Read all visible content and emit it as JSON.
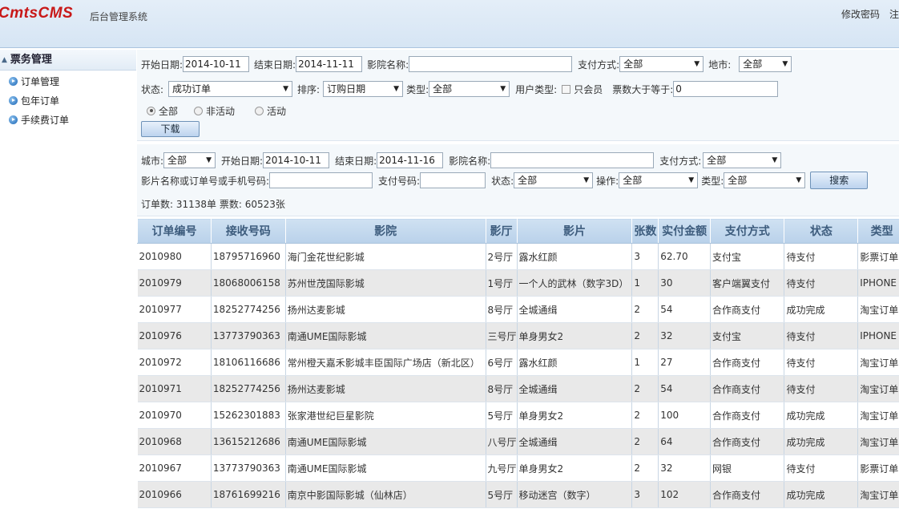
{
  "header": {
    "logo": "CmtsCMS",
    "subtitle": "后台管理系统",
    "links": [
      "修改密码",
      "注"
    ]
  },
  "sidebar": {
    "section": "票务管理",
    "items": [
      {
        "label": "订单管理"
      },
      {
        "label": "包年订单"
      },
      {
        "label": "手续费订单"
      }
    ]
  },
  "filter1": {
    "start_label": "开始日期:",
    "start_value": "2014-10-11",
    "end_label": "结束日期:",
    "end_value": "2014-11-11",
    "cinema_label": "影院名称:",
    "cinema_value": "",
    "pay_label": "支付方式:",
    "pay_value": "全部",
    "city_label": "地市:",
    "city_value": "全部",
    "status_label": "状态:",
    "status_value": "成功订单",
    "sort_label": "排序:",
    "sort_value": "订购日期",
    "type_label": "类型:",
    "type_value": "全部",
    "usertype_label": "用户类型:",
    "member_only_label": "只会员",
    "tickets_label": "票数大于等于:",
    "tickets_value": "0",
    "radios": [
      "全部",
      "非活动",
      "活动"
    ],
    "download_label": "下载"
  },
  "filter2": {
    "city_label": "城市:",
    "city_value": "全部",
    "start_label": "开始日期:",
    "start_value": "2014-10-11",
    "end_label": "结束日期:",
    "end_value": "2014-11-16",
    "cinema_label": "影院名称:",
    "cinema_value": "",
    "pay_label": "支付方式:",
    "pay_value": "全部",
    "search_field_label": "影片名称或订单号或手机号码:",
    "search_field_value": "",
    "payno_label": "支付号码:",
    "payno_value": "",
    "status_label": "状态:",
    "status_value": "全部",
    "op_label": "操作:",
    "op_value": "全部",
    "type_label": "类型:",
    "type_value": "全部",
    "search_label": "搜索",
    "summary": "订单数:  31138单  票数:  60523张"
  },
  "table": {
    "columns": [
      "订单编号",
      "接收号码",
      "影院",
      "影厅",
      "影片",
      "张数",
      "实付金额",
      "支付方式",
      "状态",
      "类型"
    ],
    "rows": [
      [
        "2010980",
        "18795716960",
        "海门金花世纪影城",
        "2号厅",
        "露水红颜",
        "3",
        "62.70",
        "支付宝",
        "待支付",
        "影票订单"
      ],
      [
        "2010979",
        "18068006158",
        "苏州世茂国际影城",
        "1号厅",
        "一个人的武林（数字3D）",
        "1",
        "30",
        "客户端翼支付",
        "待支付",
        "IPHONE"
      ],
      [
        "2010977",
        "18252774256",
        "扬州达麦影城",
        "8号厅",
        "全城通缉",
        "2",
        "54",
        "合作商支付",
        "成功完成",
        "淘宝订单"
      ],
      [
        "2010976",
        "13773790363",
        "南通UME国际影城",
        "三号厅",
        "单身男女2",
        "2",
        "32",
        "支付宝",
        "待支付",
        "IPHONE"
      ],
      [
        "2010972",
        "18106116686",
        "常州橙天嘉禾影城丰臣国际广场店（新北区）",
        "6号厅",
        "露水红颜",
        "1",
        "27",
        "合作商支付",
        "待支付",
        "淘宝订单"
      ],
      [
        "2010971",
        "18252774256",
        "扬州达麦影城",
        "8号厅",
        "全城通缉",
        "2",
        "54",
        "合作商支付",
        "待支付",
        "淘宝订单"
      ],
      [
        "2010970",
        "15262301883",
        "张家港世纪巨星影院",
        "5号厅",
        "单身男女2",
        "2",
        "100",
        "合作商支付",
        "成功完成",
        "淘宝订单"
      ],
      [
        "2010968",
        "13615212686",
        "南通UME国际影城",
        "八号厅",
        "全城通缉",
        "2",
        "64",
        "合作商支付",
        "成功完成",
        "淘宝订单"
      ],
      [
        "2010967",
        "13773790363",
        "南通UME国际影城",
        "九号厅",
        "单身男女2",
        "2",
        "32",
        "网银",
        "待支付",
        "影票订单"
      ],
      [
        "2010966",
        "18761699216",
        "南京中影国际影城（仙林店）",
        "5号厅",
        "移动迷宫（数字）",
        "3",
        "102",
        "合作商支付",
        "成功完成",
        "淘宝订单"
      ]
    ]
  }
}
